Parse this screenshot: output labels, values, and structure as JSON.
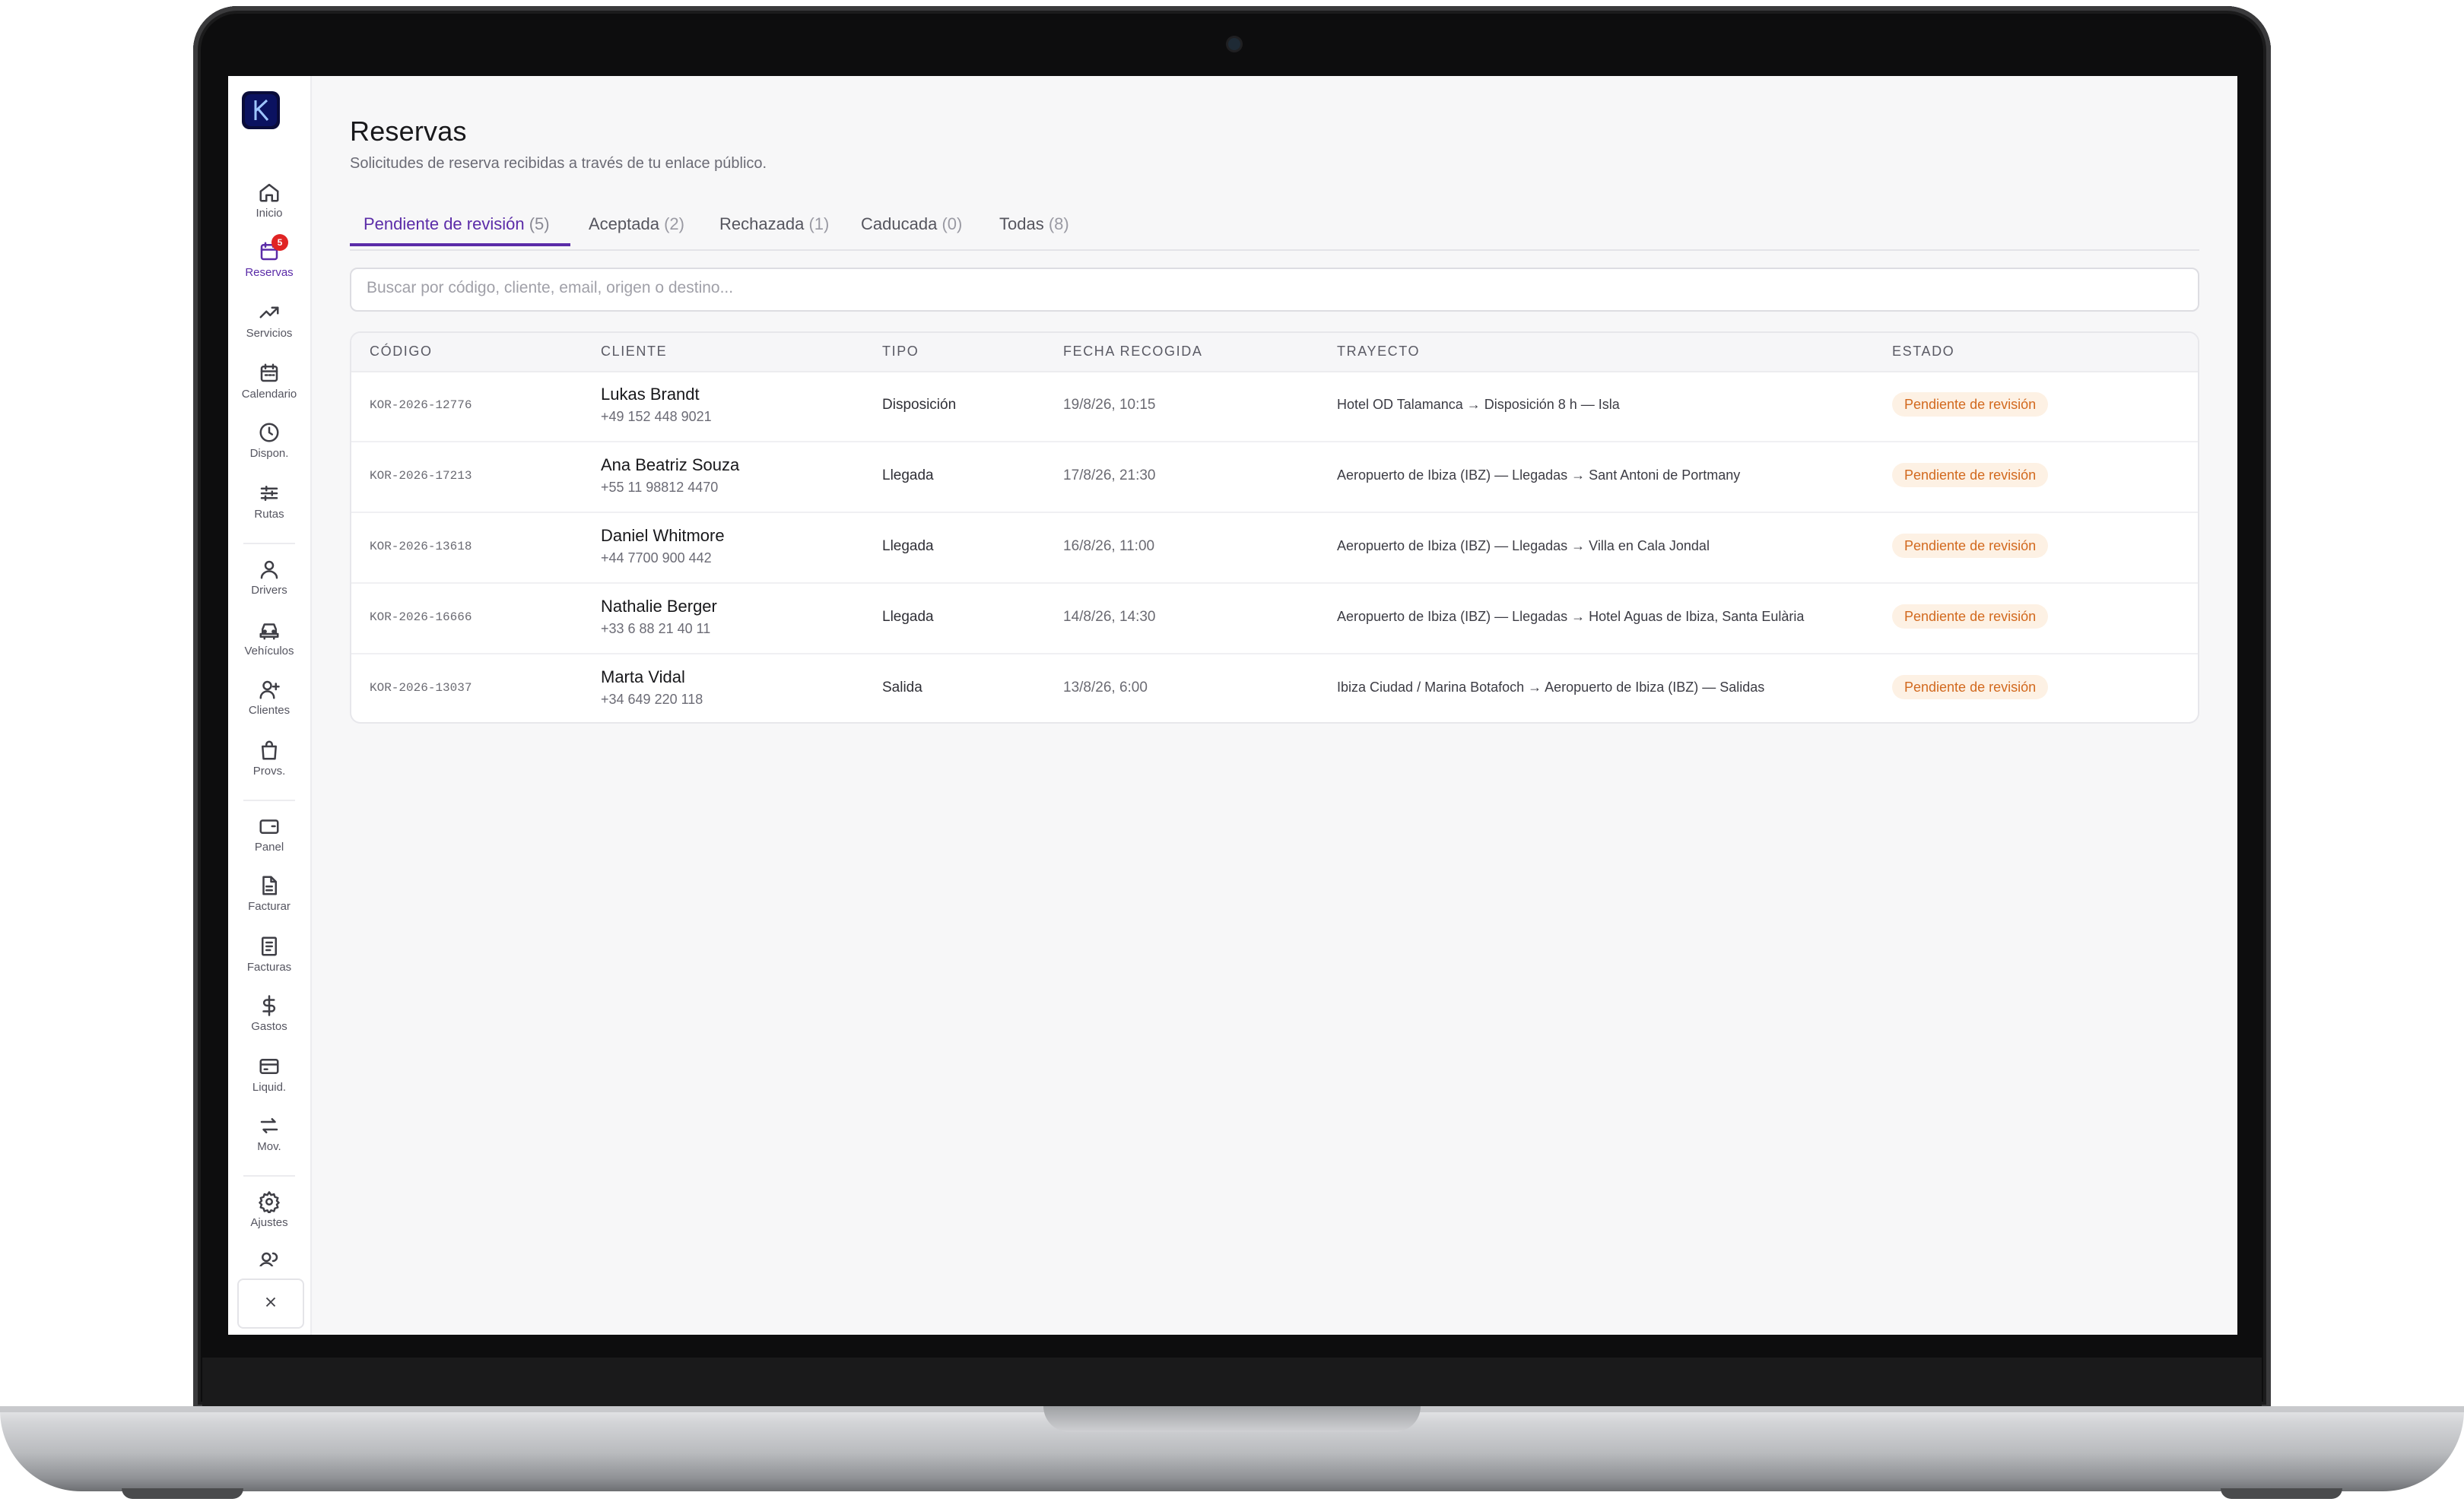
{
  "sidebar": {
    "items": [
      {
        "label": "Inicio",
        "icon": "home-icon"
      },
      {
        "label": "Reservas",
        "icon": "calendar-check-icon",
        "badge": "5",
        "active": true
      },
      {
        "label": "Servicios",
        "icon": "trending-up-icon"
      },
      {
        "label": "Calendario",
        "icon": "calendar-icon"
      },
      {
        "label": "Dispon.",
        "icon": "clock-icon"
      },
      {
        "label": "Rutas",
        "icon": "sliders-icon"
      },
      {
        "label": "Drivers",
        "icon": "user-icon"
      },
      {
        "label": "Vehículos",
        "icon": "car-icon"
      },
      {
        "label": "Clientes",
        "icon": "user-plus-icon"
      },
      {
        "label": "Provs.",
        "icon": "shopping-bag-icon"
      },
      {
        "label": "Panel",
        "icon": "wallet-icon"
      },
      {
        "label": "Facturar",
        "icon": "file-icon"
      },
      {
        "label": "Facturas",
        "icon": "receipt-icon"
      },
      {
        "label": "Gastos",
        "icon": "dollar-icon"
      },
      {
        "label": "Liquid.",
        "icon": "credit-card-icon"
      },
      {
        "label": "Mov.",
        "icon": "arrows-swap-icon"
      },
      {
        "label": "Ajustes",
        "icon": "gear-icon"
      }
    ]
  },
  "header": {
    "title": "Reservas",
    "subtitle": "Solicitudes de reserva recibidas a través de tu enlace público."
  },
  "tabs": [
    {
      "label": "Pendiente de revisión",
      "count": "(5)"
    },
    {
      "label": "Aceptada",
      "count": "(2)"
    },
    {
      "label": "Rechazada",
      "count": "(1)"
    },
    {
      "label": "Caducada",
      "count": "(0)"
    },
    {
      "label": "Todas",
      "count": "(8)"
    }
  ],
  "search": {
    "placeholder": "Buscar por código, cliente, email, origen o destino..."
  },
  "table": {
    "columns": [
      "CÓDIGO",
      "CLIENTE",
      "TIPO",
      "FECHA RECOGIDA",
      "TRAYECTO",
      "ESTADO"
    ],
    "rows": [
      {
        "code": "KOR-2026-12776",
        "name": "Lukas Brandt",
        "phone": "+49 152 448 9021",
        "tipo": "Disposición",
        "fecha": "19/8/26, 10:15",
        "trayecto": "Hotel OD Talamanca → Disposición 8 h — Isla",
        "estado": "Pendiente de revisión"
      },
      {
        "code": "KOR-2026-17213",
        "name": "Ana Beatriz Souza",
        "phone": "+55 11 98812 4470",
        "tipo": "Llegada",
        "fecha": "17/8/26, 21:30",
        "trayecto": "Aeropuerto de Ibiza (IBZ) — Llegadas → Sant Antoni de Portmany",
        "estado": "Pendiente de revisión"
      },
      {
        "code": "KOR-2026-13618",
        "name": "Daniel Whitmore",
        "phone": "+44 7700 900 442",
        "tipo": "Llegada",
        "fecha": "16/8/26, 11:00",
        "trayecto": "Aeropuerto de Ibiza (IBZ) — Llegadas → Villa en Cala Jondal",
        "estado": "Pendiente de revisión"
      },
      {
        "code": "KOR-2026-16666",
        "name": "Nathalie Berger",
        "phone": "+33 6 88 21 40 11",
        "tipo": "Llegada",
        "fecha": "14/8/26, 14:30",
        "trayecto": "Aeropuerto de Ibiza (IBZ) — Llegadas → Hotel Aguas de Ibiza, Santa Eulària",
        "estado": "Pendiente de revisión"
      },
      {
        "code": "KOR-2026-13037",
        "name": "Marta Vidal",
        "phone": "+34 649 220 118",
        "tipo": "Salida",
        "fecha": "13/8/26, 6:00",
        "trayecto": "Ibiza Ciudad / Marina Botafoch → Aeropuerto de Ibiza (IBZ) — Salidas",
        "estado": "Pendiente de revisión"
      }
    ]
  },
  "colors": {
    "accent": "#5b2ca8",
    "status_bg": "#fdf1e4",
    "status_text": "#d2691e",
    "badge": "#e02424"
  }
}
